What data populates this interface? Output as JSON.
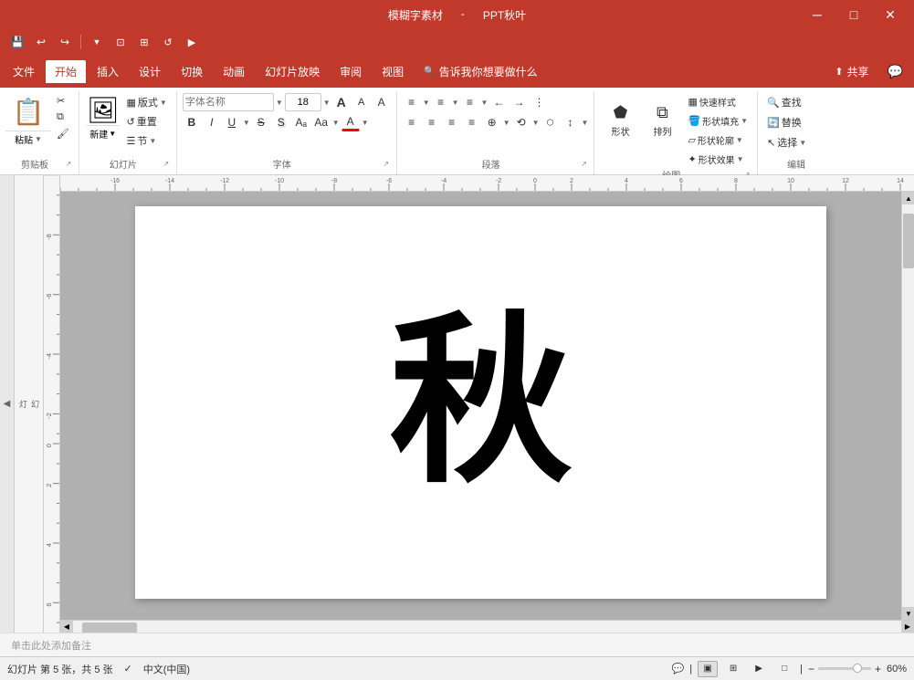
{
  "titlebar": {
    "doc_title": "模糊字素材",
    "app_title": "PPT秋叶",
    "minimize": "─",
    "maximize": "□",
    "close": "✕"
  },
  "menubar": {
    "items": [
      {
        "id": "file",
        "label": "文件"
      },
      {
        "id": "home",
        "label": "开始",
        "active": true
      },
      {
        "id": "insert",
        "label": "插入"
      },
      {
        "id": "design",
        "label": "设计"
      },
      {
        "id": "transitions",
        "label": "切换"
      },
      {
        "id": "animations",
        "label": "动画"
      },
      {
        "id": "slideshow",
        "label": "幻灯片放映"
      },
      {
        "id": "review",
        "label": "审阅"
      },
      {
        "id": "view",
        "label": "视图"
      },
      {
        "id": "help",
        "label": "告诉我你想要做什么"
      }
    ],
    "share": "共享",
    "comment_icon": "💬"
  },
  "quicktoolbar": {
    "save": "💾",
    "undo": "↩",
    "redo": "↪",
    "more": "▼"
  },
  "ribbon": {
    "groups": {
      "clipboard": {
        "label": "剪贴板",
        "paste": "粘贴",
        "cut": "✂",
        "copy": "⧉",
        "format_paint": "🖌"
      },
      "slides": {
        "label": "幻灯片",
        "new": "新建",
        "layout": "版式",
        "reset": "重置",
        "section": "节"
      },
      "font": {
        "label": "字体",
        "font_name": "",
        "font_size": "18",
        "grow": "A",
        "shrink": "A",
        "clear": "A",
        "bold": "B",
        "italic": "I",
        "underline": "U",
        "strikethrough": "S",
        "shadow": "S",
        "spacing": "Aₐ",
        "color_arrow": "▼",
        "font_color": "A",
        "case": "Aa",
        "case_arrow": "▼"
      },
      "paragraph": {
        "label": "段落",
        "list_bullet": "≡",
        "list_num": "≡",
        "list_multi": "≡",
        "decrease_indent": "←",
        "increase_indent": "→",
        "col_style": "⋮",
        "align_left": "≡",
        "align_center": "≡",
        "align_right": "≡",
        "justify": "≡",
        "align_v_top": "⊤",
        "align_v_mid": "⊕",
        "align_v_bot": "⊥",
        "smart_art": "SmartArt",
        "line_space": "↕",
        "direction": "⟲"
      },
      "drawing": {
        "label": "绘图",
        "shape": "形状",
        "arrange": "排列",
        "quick_style": "快速样式",
        "fill": "形状填充",
        "outline": "形状轮廓",
        "effect": "形状效果"
      },
      "editing": {
        "label": "编辑",
        "find": "查找",
        "replace": "替换",
        "select": "选择"
      }
    }
  },
  "canvas": {
    "char": "秋",
    "notes_placeholder": "单击此处添加备注"
  },
  "statusbar": {
    "slide_info": "幻灯片 第 5 张，共 5 张",
    "spell_check": "✓",
    "language": "中文(中国)",
    "zoom_level": "60%",
    "view_normal": "▣",
    "view_slide_sorter": "⊞",
    "view_reading": "▶",
    "view_presenter": "□"
  },
  "sidebar": {
    "toggle": "◀",
    "panel_label": "幻\n灯\n片"
  }
}
